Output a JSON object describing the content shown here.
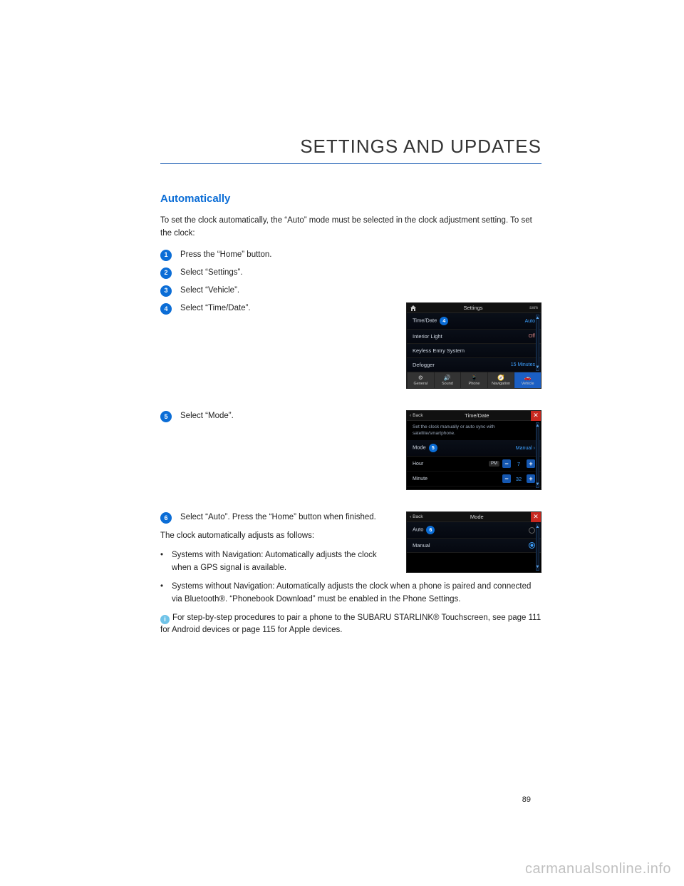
{
  "chapter": "SETTINGS AND UPDATES",
  "section_title": "Automatically",
  "intro": "To set the clock automatically, the “Auto” mode must be selected in the clock adjustment setting. To set the clock:",
  "steps": {
    "s1": {
      "num": "1",
      "text": "Press the “Home” button."
    },
    "s2": {
      "num": "2",
      "text": "Select “Settings”."
    },
    "s3": {
      "num": "3",
      "text": "Select “Vehicle”."
    },
    "s4": {
      "num": "4",
      "text": "Select “Time/Date”."
    },
    "s5": {
      "num": "5",
      "text": "Select “Mode”."
    },
    "s6": {
      "num": "6",
      "text": "Select “Auto”. Press the “Home” button when finished."
    }
  },
  "after_steps": "The clock automatically adjusts as follows:",
  "bullets": {
    "b1": "Systems with Navigation: Automatically adjusts the clock when a GPS signal is available.",
    "b2": "Systems without Navigation: Automatically adjusts the clock when a phone is paired and connected via Bluetooth®. “Phonebook Download” must be enabled in the Phone Settings."
  },
  "info": "For step-by-step procedures to pair a phone to the SUBARU STARLINK® Touchscreen, see page 111 for Android devices or page 115 for Apple devices.",
  "page_number": "89",
  "watermark": "carmanualsonline.info",
  "screen4": {
    "header": "Settings",
    "brand": "sxm",
    "rows": {
      "r1": {
        "label": "Time/Date",
        "value": "Auto",
        "marker": "4"
      },
      "r2": {
        "label": "Interior Light",
        "value": "Off"
      },
      "r3": {
        "label": "Keyless Entry System",
        "value": ""
      },
      "r4": {
        "label": "Defogger",
        "value": "15 Minutes"
      }
    },
    "tabs": {
      "t1": "General",
      "t2": "Sound",
      "t3": "Phone",
      "t4": "Navigation",
      "t5": "Vehicle"
    }
  },
  "screen5": {
    "back": "Back",
    "title": "Time/Date",
    "desc": "Set the clock manually or auto sync with satellite/smartphone.",
    "mode": {
      "label": "Mode",
      "value": "Manual",
      "marker": "5"
    },
    "hour": {
      "label": "Hour",
      "ampm": "PM",
      "value": "7"
    },
    "minute": {
      "label": "Minute",
      "value": "32"
    }
  },
  "screen6": {
    "back": "Back",
    "title": "Mode",
    "auto": {
      "label": "Auto",
      "marker": "6"
    },
    "manual": {
      "label": "Manual"
    }
  }
}
